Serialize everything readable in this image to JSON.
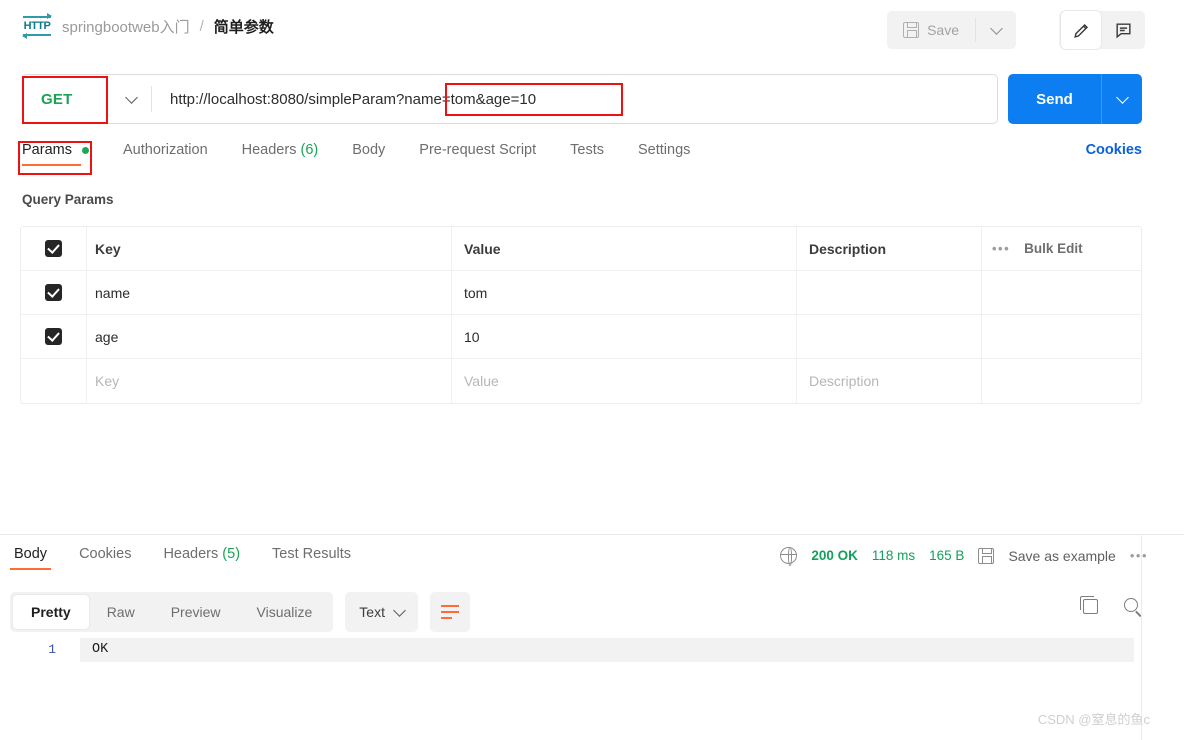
{
  "header": {
    "protocol_icon": "http-icon",
    "breadcrumb_parent": "springbootweb入门",
    "breadcrumb_sep": "/",
    "breadcrumb_current": "简单参数",
    "save_label": "Save",
    "save_icon": "disk-icon",
    "save_caret_icon": "chevron-down-icon",
    "edit_icon": "pencil-icon",
    "comment_icon": "comment-icon"
  },
  "request": {
    "method": "GET",
    "method_caret_icon": "chevron-down-icon",
    "url": "http://localhost:8080/simpleParam?name=tom&age=10",
    "url_base": "http://localhost:8080/simpleParam",
    "url_query": "?name=tom&age=10",
    "send_label": "Send",
    "send_caret_icon": "chevron-down-icon"
  },
  "request_tabs": [
    {
      "label": "Params",
      "active": true,
      "dot": true
    },
    {
      "label": "Authorization",
      "active": false
    },
    {
      "label": "Headers",
      "count": "(6)",
      "active": false
    },
    {
      "label": "Body",
      "active": false
    },
    {
      "label": "Pre-request Script",
      "active": false
    },
    {
      "label": "Tests",
      "active": false
    },
    {
      "label": "Settings",
      "active": false
    }
  ],
  "cookies_link": "Cookies",
  "query_params": {
    "section_label": "Query Params",
    "columns": {
      "key": "Key",
      "value": "Value",
      "description": "Description"
    },
    "bulk_edit_label": "Bulk Edit",
    "more_icon": "ellipsis-icon",
    "rows": [
      {
        "checked": true,
        "key": "name",
        "value": "tom",
        "description": ""
      },
      {
        "checked": true,
        "key": "age",
        "value": "10",
        "description": ""
      }
    ],
    "placeholder_row": {
      "key": "Key",
      "value": "Value",
      "description": "Description"
    }
  },
  "response_tabs": [
    {
      "label": "Body",
      "active": true
    },
    {
      "label": "Cookies",
      "active": false
    },
    {
      "label": "Headers",
      "count": "(5)",
      "active": false
    },
    {
      "label": "Test Results",
      "active": false
    }
  ],
  "response_status": {
    "globe_icon": "globe-icon",
    "status": "200 OK",
    "time": "118 ms",
    "size": "165 B",
    "save_example_icon": "disk-icon",
    "save_example_label": "Save as example",
    "more_icon": "ellipsis-icon"
  },
  "response_view": {
    "modes": [
      {
        "label": "Pretty",
        "active": true
      },
      {
        "label": "Raw",
        "active": false
      },
      {
        "label": "Preview",
        "active": false
      },
      {
        "label": "Visualize",
        "active": false
      }
    ],
    "format": "Text",
    "format_caret_icon": "chevron-down-icon",
    "wrap_icon": "wrap-lines-icon",
    "copy_icon": "copy-icon",
    "search_icon": "search-icon"
  },
  "response_body": {
    "lines": [
      {
        "number": "1",
        "text": "OK"
      }
    ]
  },
  "annotations": [
    {
      "name": "method-highlight"
    },
    {
      "name": "query-string-highlight"
    },
    {
      "name": "params-tab-highlight"
    }
  ],
  "watermark": "CSDN @窒息的鱼c",
  "colors": {
    "accent_orange": "#ff6c37",
    "send_blue": "#0d7df2",
    "link_blue": "#0b61d8",
    "success_green": "#14a05a",
    "method_green": "#1aa356",
    "annotation_red": "#ee1111"
  }
}
